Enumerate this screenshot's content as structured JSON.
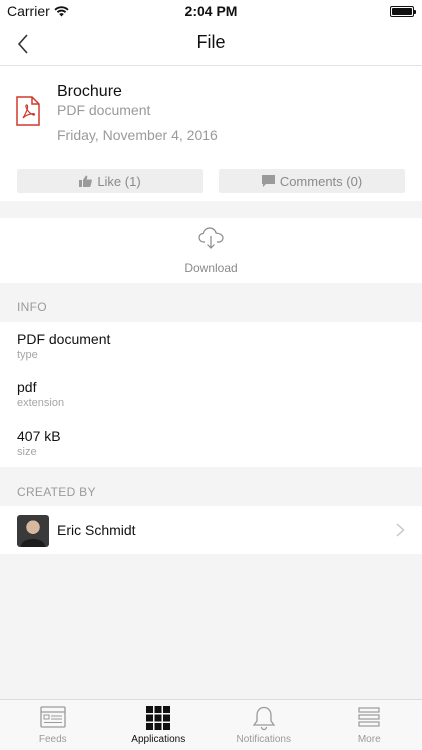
{
  "status_bar": {
    "carrier": "Carrier",
    "time": "2:04 PM"
  },
  "nav": {
    "title": "File"
  },
  "file": {
    "name": "Brochure",
    "type": "PDF document",
    "date": "Friday, November 4, 2016"
  },
  "actions": {
    "like": "Like (1)",
    "comments": "Comments (0)"
  },
  "download": {
    "label": "Download"
  },
  "info": {
    "header": "INFO",
    "rows": [
      {
        "value": "PDF document",
        "key": "type"
      },
      {
        "value": "pdf",
        "key": "extension"
      },
      {
        "value": "407 kB",
        "key": "size"
      }
    ]
  },
  "created_by": {
    "header": "CREATED BY",
    "name": "Eric Schmidt"
  },
  "tabs": [
    {
      "label": "Feeds",
      "icon": "feeds-icon"
    },
    {
      "label": "Applications",
      "icon": "applications-icon"
    },
    {
      "label": "Notifications",
      "icon": "bell-icon"
    },
    {
      "label": "More",
      "icon": "more-icon"
    }
  ],
  "colors": {
    "accent_red": "#d0382c",
    "text": "#111111",
    "muted": "#9a9a9a"
  }
}
